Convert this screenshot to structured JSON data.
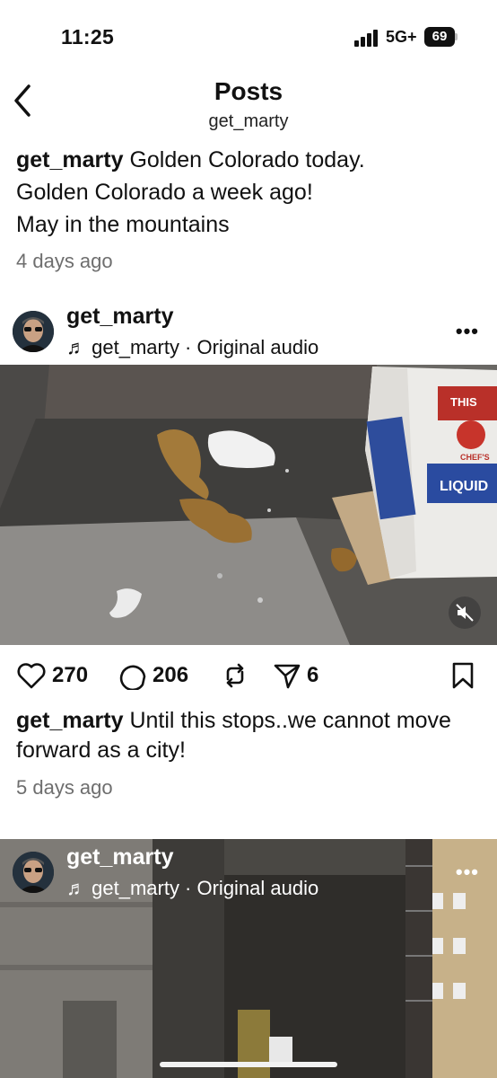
{
  "status_bar": {
    "time": "11:25",
    "network": "5G+",
    "battery": "69"
  },
  "header": {
    "title": "Posts",
    "subtitle": "get_marty"
  },
  "post_prev": {
    "username": "get_marty",
    "caption_lines": [
      "Golden Colorado today.",
      "Golden Colorado a week ago!",
      "May in the mountains"
    ],
    "timestamp": "4 days ago"
  },
  "post_main": {
    "username": "get_marty",
    "audio": "get_marty · Original audio",
    "likes": "270",
    "comments": "206",
    "shares": "6",
    "caption_username": "get_marty",
    "caption": "Until this stops..we cannot move forward as a city!",
    "timestamp": "5 days ago",
    "box_text": {
      "this": "THIS",
      "brand": "LIQUID",
      "chefs": "CHEF'S"
    }
  },
  "post_next": {
    "username": "get_marty",
    "audio": "get_marty · Original audio"
  },
  "icons": [
    "back-chevron-icon",
    "music-note-icon",
    "more-dots-icon",
    "heart-icon",
    "comment-icon",
    "repost-icon",
    "share-icon",
    "bookmark-icon",
    "mute-icon"
  ]
}
